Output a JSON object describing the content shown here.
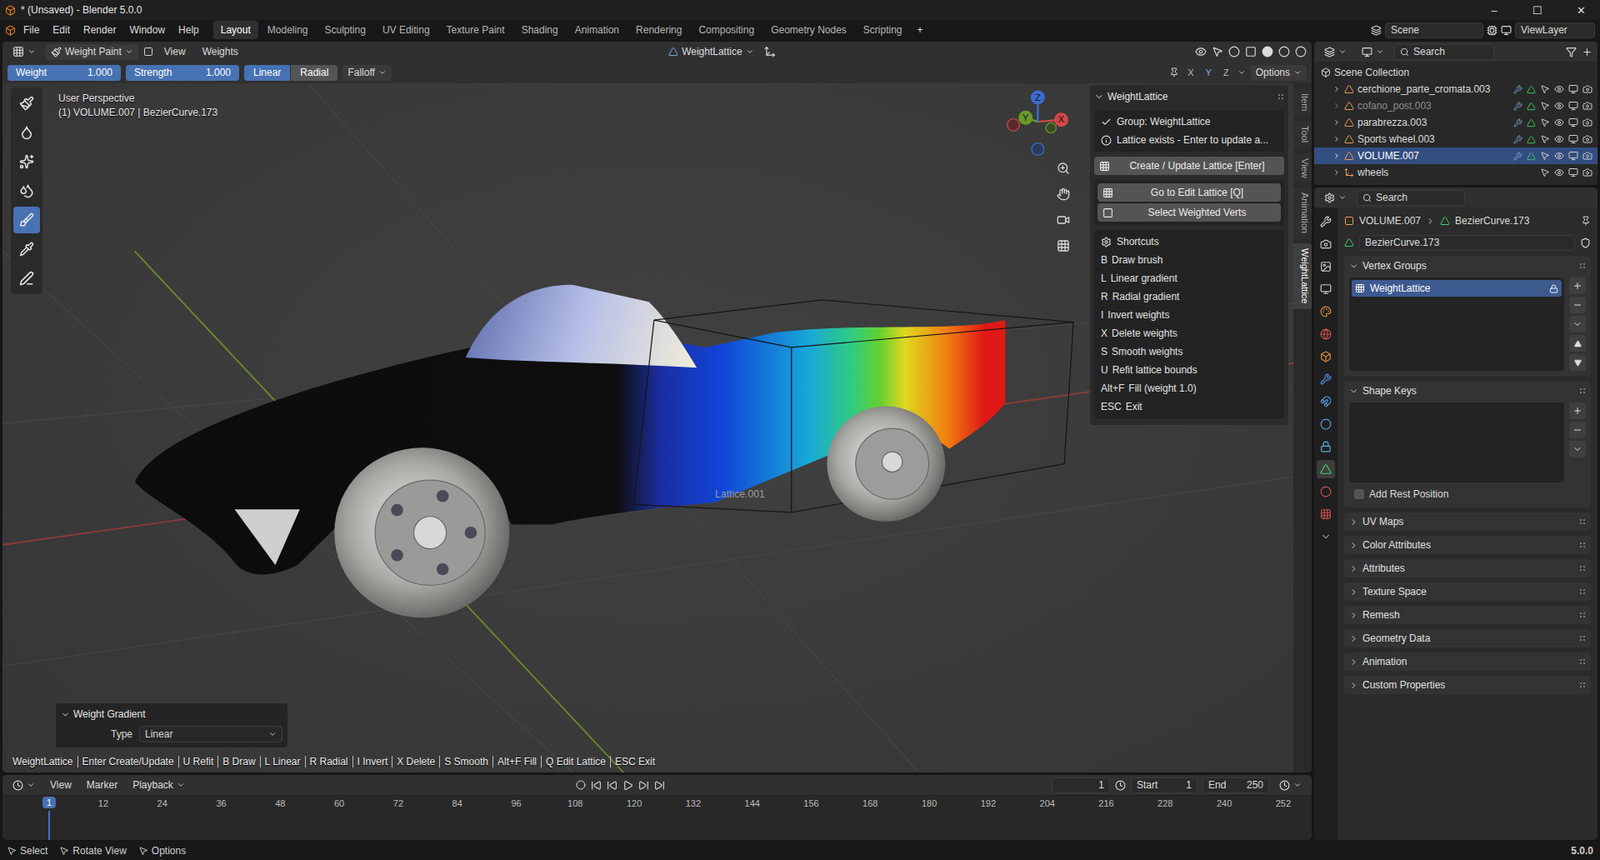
{
  "window": {
    "title": "* (Unsaved) - Blender 5.0.0",
    "controls": [
      "–",
      "☐",
      "✕"
    ]
  },
  "menus": [
    "File",
    "Edit",
    "Render",
    "Window",
    "Help"
  ],
  "workspaces": [
    {
      "label": "Layout",
      "selected": true
    },
    {
      "label": "Modeling",
      "selected": false
    },
    {
      "label": "Sculpting",
      "selected": false
    },
    {
      "label": "UV Editing",
      "selected": false
    },
    {
      "label": "Texture Paint",
      "selected": false
    },
    {
      "label": "Shading",
      "selected": false
    },
    {
      "label": "Animation",
      "selected": false
    },
    {
      "label": "Rendering",
      "selected": false
    },
    {
      "label": "Compositing",
      "selected": false
    },
    {
      "label": "Geometry Nodes",
      "selected": false
    },
    {
      "label": "Scripting",
      "selected": false
    }
  ],
  "add_workspace": "+",
  "scene": {
    "name": "Scene",
    "view_layer": "ViewLayer"
  },
  "viewport_header": {
    "mode": "Weight Paint",
    "menus": [
      "View",
      "Weights"
    ],
    "vertex_group": "WeightLattice",
    "mirror": [
      {
        "label": "X",
        "selected": false
      },
      {
        "label": "Y",
        "selected": true
      },
      {
        "label": "Z",
        "selected": false
      }
    ],
    "options": "Options"
  },
  "tool_settings": {
    "weight": {
      "label": "Weight",
      "value": "1.000",
      "level": 1
    },
    "strength": {
      "label": "Strength",
      "value": "1.000",
      "level": 1
    },
    "types": [
      {
        "label": "Linear",
        "selected": true
      },
      {
        "label": "Radial",
        "selected": false
      }
    ],
    "falloff": "Falloff"
  },
  "toolbar": {
    "tools": [
      {
        "selected": false
      },
      {
        "selected": false
      },
      {
        "selected": false
      },
      {
        "selected": false
      },
      {
        "selected": true
      },
      {
        "selected": false
      },
      {
        "selected": false
      }
    ]
  },
  "viewport": {
    "perspective": "User Perspective",
    "object_info": "(1) VOLUME.007 | BezierCurve.173",
    "object_label": "Lattice.001",
    "gizmo_axes": [
      "X",
      "Y",
      "Z"
    ]
  },
  "n_panel": {
    "title": "WeightLattice",
    "status": [
      {
        "text": "Group: WeightLattice",
        "kind": "check"
      },
      {
        "text": "Lattice exists - Enter to update a...",
        "kind": "info"
      }
    ],
    "primary_button": "Create / Update Lattice  [Enter]",
    "buttons": [
      "Go to Edit Lattice  [Q]",
      "Select Weighted Verts"
    ],
    "shortcuts_title": "Shortcuts",
    "shortcuts": [
      {
        "key": "B",
        "label": "Draw brush"
      },
      {
        "key": "L",
        "label": "Linear gradient"
      },
      {
        "key": "R",
        "label": "Radial gradient"
      },
      {
        "key": "I",
        "label": "Invert weights"
      },
      {
        "key": "X",
        "label": "Delete weights"
      },
      {
        "key": "S",
        "label": "Smooth weights"
      },
      {
        "key": "U",
        "label": "Refit lattice bounds"
      },
      {
        "key": "Alt+F",
        "label": "Fill (weight 1.0)"
      },
      {
        "key": "ESC",
        "label": "Exit"
      }
    ]
  },
  "side_tabs": [
    {
      "label": "Item",
      "selected": false
    },
    {
      "label": "Tool",
      "selected": false
    },
    {
      "label": "View",
      "selected": false
    },
    {
      "label": "Animation",
      "selected": false
    },
    {
      "label": "WeightLattice",
      "selected": true
    }
  ],
  "operator_panel": {
    "title": "Weight Gradient",
    "field": "Type",
    "value": "Linear"
  },
  "hint_bar": [
    "WeightLattice",
    "Enter Create/Update",
    "U Refit",
    "B Draw",
    "L Linear",
    "R Radial",
    "I Invert",
    "X Delete",
    "S Smooth",
    "Alt+F Fill",
    "Q Edit Lattice",
    "ESC Exit"
  ],
  "timeline": {
    "menus": [
      "View",
      "Marker",
      "Playback"
    ],
    "current_frame": "1",
    "start": {
      "label": "Start",
      "value": "1"
    },
    "end": {
      "label": "End",
      "value": "250"
    },
    "ticks": [
      "12",
      "24",
      "36",
      "48",
      "60",
      "72",
      "84",
      "96",
      "108",
      "120",
      "132",
      "144",
      "156",
      "168",
      "180",
      "192",
      "204",
      "216",
      "228",
      "240",
      "252"
    ]
  },
  "outliner": {
    "search": "Search",
    "root": "Scene Collection",
    "items": [
      {
        "name": "cerchione_parte_cromata.003",
        "kind": "mesh",
        "selected": false,
        "disabled": false
      },
      {
        "name": "cofano_post.003",
        "kind": "mesh",
        "selected": false,
        "disabled": true
      },
      {
        "name": "parabrezza.003",
        "kind": "mesh",
        "selected": false,
        "disabled": false
      },
      {
        "name": "Sports wheel.003",
        "kind": "mesh",
        "selected": false,
        "disabled": false
      },
      {
        "name": "VOLUME.007",
        "kind": "mesh",
        "selected": true,
        "disabled": false
      },
      {
        "name": "wheels",
        "kind": "empty",
        "selected": false,
        "disabled": false
      }
    ]
  },
  "properties": {
    "search": "Search",
    "tabs": [
      {
        "selected": false
      },
      {
        "selected": false
      },
      {
        "selected": false
      },
      {
        "selected": false
      },
      {
        "selected": false
      },
      {
        "selected": false
      },
      {
        "selected": false
      },
      {
        "selected": false
      },
      {
        "selected": false
      },
      {
        "selected": false
      },
      {
        "selected": false
      },
      {
        "selected": true
      },
      {
        "selected": false
      },
      {
        "selected": false
      },
      {
        "selected": false
      }
    ],
    "breadcrumb": [
      "VOLUME.007",
      "BezierCurve.173"
    ],
    "data_name": "BezierCurve.173",
    "vertex_groups": {
      "title": "Vertex Groups",
      "items": [
        {
          "name": "WeightLattice",
          "selected": true
        }
      ]
    },
    "shape_keys": {
      "title": "Shape Keys"
    },
    "add_rest_position": {
      "label": "Add Rest Position",
      "checked": false
    },
    "panels": [
      "UV Maps",
      "Color Attributes",
      "Attributes",
      "Texture Space",
      "Remesh",
      "Geometry Data",
      "Animation",
      "Custom Properties"
    ]
  },
  "status_bar": {
    "hints": [
      "Select",
      "Rotate View",
      "Options"
    ],
    "version": "5.0.0"
  }
}
